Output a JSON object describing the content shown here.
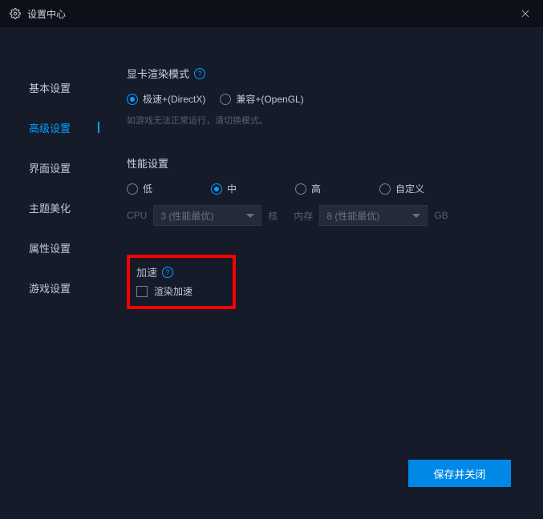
{
  "titlebar": {
    "title": "设置中心"
  },
  "sidebar": {
    "items": [
      {
        "label": "基本设置"
      },
      {
        "label": "高级设置"
      },
      {
        "label": "界面设置"
      },
      {
        "label": "主题美化"
      },
      {
        "label": "属性设置"
      },
      {
        "label": "游戏设置"
      }
    ],
    "active_index": 1
  },
  "render_mode": {
    "title": "显卡渲染模式",
    "options": [
      {
        "label": "极速+(DirectX)",
        "selected": true
      },
      {
        "label": "兼容+(OpenGL)",
        "selected": false
      }
    ],
    "hint": "如游戏无法正常运行，请切换模式。"
  },
  "performance": {
    "title": "性能设置",
    "options": [
      {
        "label": "低",
        "selected": false
      },
      {
        "label": "中",
        "selected": true
      },
      {
        "label": "高",
        "selected": false
      },
      {
        "label": "自定义",
        "selected": false
      }
    ],
    "cpu_label": "CPU",
    "cpu_value": "3 (性能最优)",
    "cores_unit": "核",
    "mem_label": "内存",
    "mem_value": "8 (性能最优)",
    "mem_unit": "GB"
  },
  "accel": {
    "title": "加速",
    "checkbox_label": "渲染加速",
    "checked": false
  },
  "footer": {
    "save_label": "保存并关闭"
  }
}
